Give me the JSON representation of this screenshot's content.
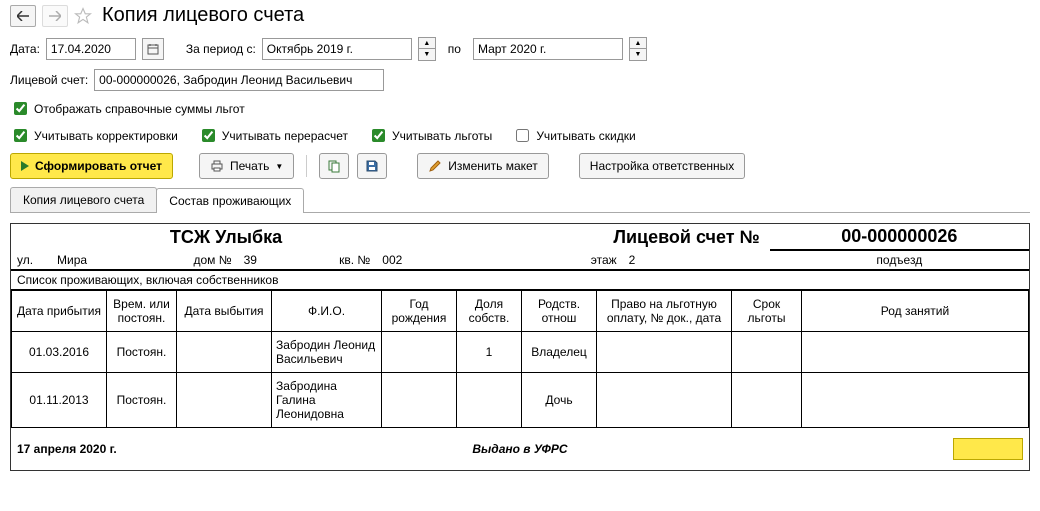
{
  "title": "Копия лицевого счета",
  "dateLabel": "Дата:",
  "dateValue": "17.04.2020",
  "periodFromLabel": "За период с:",
  "periodFrom": "Октябрь 2019 г.",
  "periodToLabel": "по",
  "periodTo": "Март 2020 г.",
  "accountLabel": "Лицевой счет:",
  "accountValue": "00-000000026, Забродин Леонид Васильевич",
  "checkboxes": {
    "show_benefit_sums": "Отображать справочные суммы льгот",
    "adjustments": "Учитывать корректировки",
    "recalculation": "Учитывать перерасчет",
    "benefits": "Учитывать льготы",
    "discounts": "Учитывать скидки"
  },
  "toolbar": {
    "generate": "Сформировать отчет",
    "print": "Печать",
    "change_layout": "Изменить макет",
    "responsible_settings": "Настройка ответственных"
  },
  "tabs": {
    "copy": "Копия лицевого счета",
    "residents": "Состав проживающих"
  },
  "report": {
    "org": "ТСЖ Улыбка",
    "account_title": "Лицевой счет  №",
    "account_no": "00-000000026",
    "street_label": "ул.",
    "street": "Мира",
    "house_label": "дом №",
    "house": "39",
    "apt_label": "кв. №",
    "apt": "002",
    "floor_label": "этаж",
    "floor": "2",
    "entrance_label": "подъезд",
    "list_title": "Список проживающих, включая собственников",
    "columns": {
      "arrival": "Дата прибытия",
      "temp": "Врем. или постоян.",
      "departure": "Дата выбытия",
      "fio": "Ф.И.О.",
      "birth_year": "Год рождения",
      "share": "Доля собств.",
      "relation": "Родств. отнош",
      "benefit_right": "Право на льгот­ную оплату, № док., дата",
      "benefit_term": "Срок льготы",
      "occupation": "Род занятий"
    },
    "rows": [
      {
        "arrival": "01.03.2016",
        "temp": "Постоян.",
        "departure": "",
        "fio": "Забродин Леонид Васильевич",
        "birth_year": "",
        "share": "1",
        "relation": "Владелец",
        "benefit_right": "",
        "benefit_term": "",
        "occupation": ""
      },
      {
        "arrival": "01.11.2013",
        "temp": "Постоян.",
        "departure": "",
        "fio": "Забродина Галина Леонидовна",
        "birth_year": "",
        "share": "",
        "relation": "Дочь",
        "benefit_right": "",
        "benefit_term": "",
        "occupation": ""
      }
    ],
    "footer_date": "17 апреля 2020 г.",
    "footer_issued": "Выдано в УФРС"
  }
}
